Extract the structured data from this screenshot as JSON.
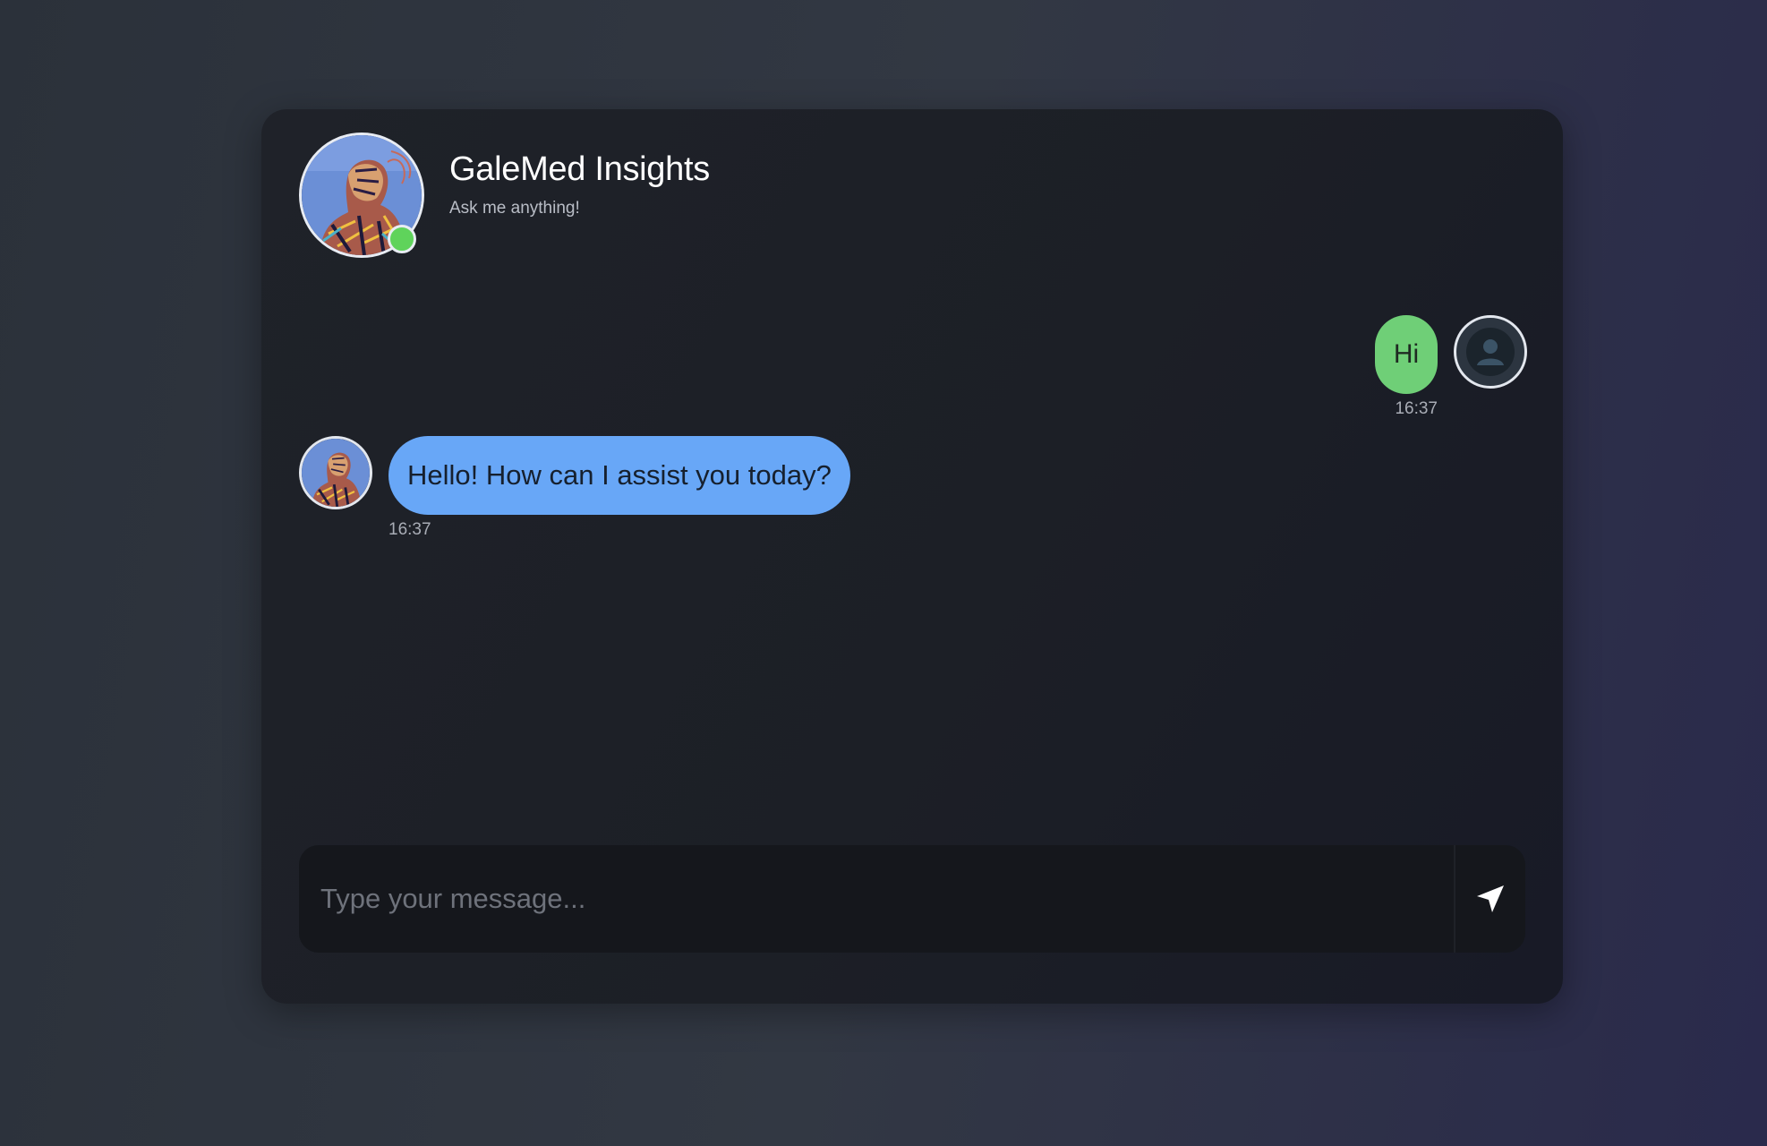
{
  "header": {
    "title": "GaleMed Insights",
    "subtitle": "Ask me anything!",
    "status": "online"
  },
  "messages": [
    {
      "sender": "user",
      "text": "Hi",
      "time": "16:37"
    },
    {
      "sender": "bot",
      "text": "Hello! How can I assist you today?",
      "time": "16:37"
    }
  ],
  "composer": {
    "placeholder": "Type your message...",
    "value": "",
    "send_icon": "send-icon"
  },
  "colors": {
    "user_bubble": "#6fcf77",
    "bot_bubble": "#68a7f7",
    "online_status": "#5fd35b"
  }
}
